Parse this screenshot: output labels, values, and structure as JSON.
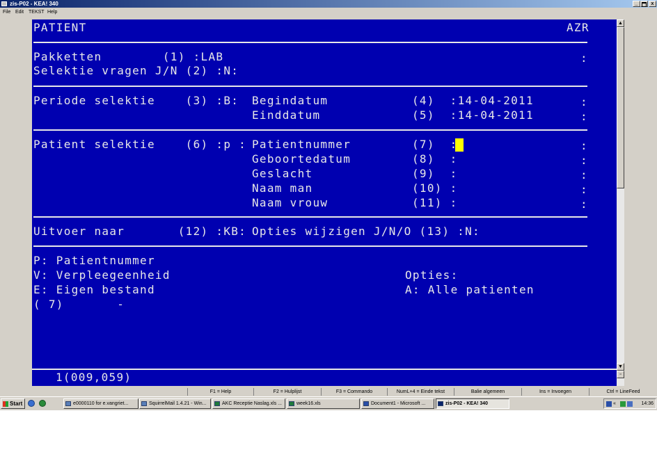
{
  "window": {
    "title": "zis-P02 - KEA! 340",
    "controls": [
      "_",
      " ",
      "x"
    ]
  },
  "menu": [
    "File",
    "Edit",
    "TEKST",
    "Help"
  ],
  "terminal": {
    "header_left": "PATIENT",
    "header_right": "AZR",
    "lines": {
      "pakketten": "Pakketten        (1) :LAB",
      "selektie_vragen": "Selektie vragen J/N (2) :N:",
      "periode": "Periode selektie    (3) :B:",
      "begindatum": "Begindatum",
      "begindatum_val": "(4)  :14-04-2011",
      "einddatum": "Einddatum",
      "einddatum_val": "(5)  :14-04-2011",
      "patient_selektie": "Patient selektie    (6) :p :",
      "patientnummer": "Patientnummer",
      "patientnummer_val": "(7)  :",
      "geboortedatum": "Geboortedatum",
      "geboortedatum_val": "(8)  :",
      "geslacht": "Geslacht",
      "geslacht_val": "(9)  :",
      "naam_man": "Naam man",
      "naam_man_val": "(10) :",
      "naam_vrouw": "Naam vrouw",
      "naam_vrouw_val": "(11) :",
      "uitvoer": "Uitvoer naar       (12) :KB:",
      "opties_wijzigen": "Opties wijzigen J/N/O (13) :N:",
      "legend_p": "P: Patientnummer",
      "legend_v": "V: Verpleegeenheid",
      "legend_e": "E: Eigen bestand",
      "legend_7": "( 7)       -",
      "opties": "Opties:",
      "opties_a": "A: Alle patienten"
    },
    "colon_marker": ":",
    "status_line": "1(009,059)"
  },
  "fkeys": [
    "",
    "F1 = Help",
    "F2 = Hulplijst",
    "F3 = Commando",
    "NumL+4 = Einde tekst",
    "Balie algemeen",
    "Ins = Invoegen",
    "Ctrl = LineFeed"
  ],
  "taskbar": {
    "start_label": "Start",
    "tasks": [
      "e0000110 for e.vangriet...",
      "SquirrelMail 1.4.21 - Win...",
      "AKC Receptie Naslag.xls ...",
      "week16.xls",
      "Document1 - Microsoft ...",
      "zis-P02 - KEA! 340"
    ],
    "clock": "14:36"
  },
  "colors": {
    "terminal_bg": "#0000b0",
    "terminal_fg": "#e8e8e8",
    "cursor": "#ffff00",
    "chrome": "#d4d0c8",
    "titlebar": "#0a246a"
  }
}
